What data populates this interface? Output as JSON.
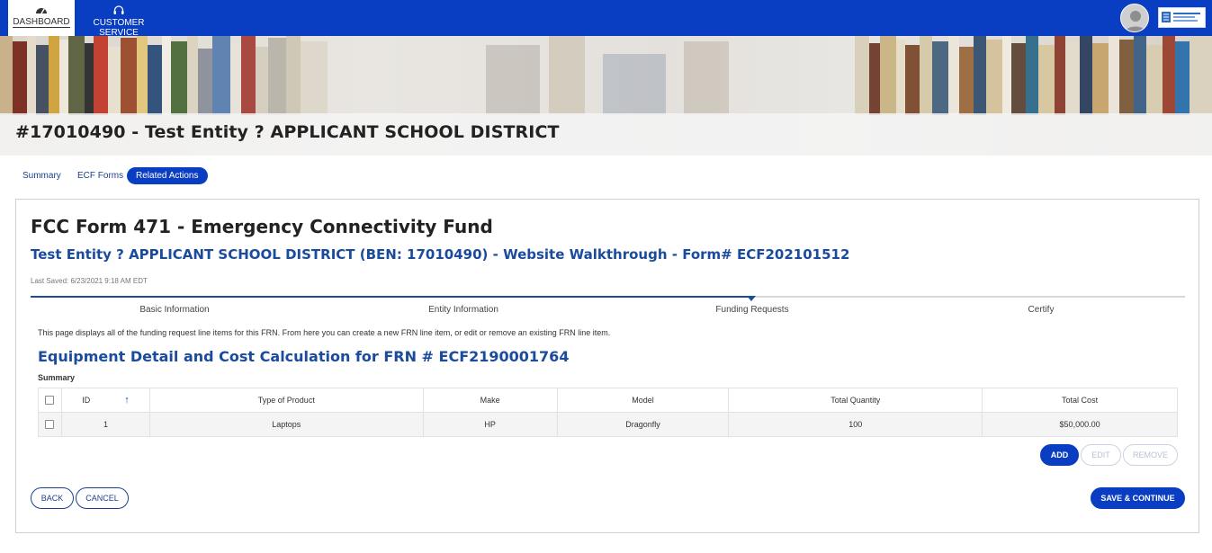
{
  "topnav": {
    "dashboard_label": "DASHBOARD",
    "dashboard_icon": "gauge-icon",
    "customer_service_label": "CUSTOMER SERVICE",
    "customer_service_icon": "headset-icon"
  },
  "header": {
    "title": "#17010490 - Test Entity ? APPLICANT SCHOOL DISTRICT"
  },
  "tabs": [
    {
      "label": "Summary",
      "active": false
    },
    {
      "label": "ECF Forms",
      "active": false
    },
    {
      "label": "Related Actions",
      "active": true
    }
  ],
  "form": {
    "title": "FCC Form 471 - Emergency Connectivity Fund",
    "subtitle": "Test Entity ? APPLICANT SCHOOL DISTRICT (BEN: 17010490) - Website Walkthrough - Form# ECF202101512",
    "last_saved": "Last Saved: 6/23/2021 9:18 AM EDT"
  },
  "stepper": {
    "steps": [
      "Basic Information",
      "Entity Information",
      "Funding Requests",
      "Certify"
    ],
    "current_step": "Funding Requests"
  },
  "content": {
    "intro": "This page displays all of the funding request line items for this FRN. From here you can create a new FRN line item, or edit or remove an existing FRN line item.",
    "section_title": "Equipment Detail and Cost Calculation for FRN # ECF2190001764",
    "summary_label": "Summary"
  },
  "table": {
    "columns": [
      "ID",
      "Type of Product",
      "Make",
      "Model",
      "Total Quantity",
      "Total Cost"
    ],
    "rows": [
      {
        "id": "1",
        "type": "Laptops",
        "make": "HP",
        "model": "Dragonfly",
        "quantity": "100",
        "cost": "$50,000.00"
      }
    ]
  },
  "actions": {
    "add": "ADD",
    "edit": "EDIT",
    "remove": "REMOVE",
    "back": "BACK",
    "cancel": "CANCEL",
    "save_continue": "SAVE & CONTINUE"
  },
  "colors": {
    "brand_blue": "#0a3ec2",
    "heading_blue": "#1a4b9c"
  }
}
